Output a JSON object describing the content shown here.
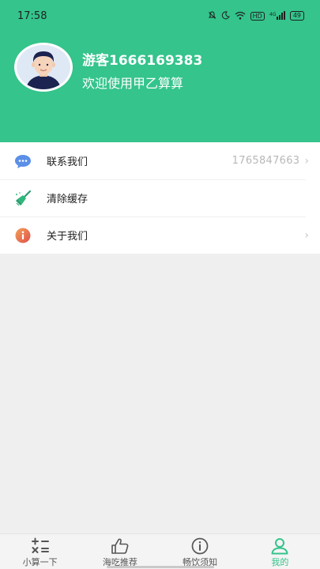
{
  "status_bar": {
    "time": "17:58",
    "signal_badge": "HD",
    "network_label": "4G",
    "battery": "49"
  },
  "profile": {
    "username": "游客1666169383",
    "welcome": "欢迎使用甲乙算算"
  },
  "menu": {
    "items": [
      {
        "label": "联系我们",
        "value": "1765847663",
        "icon": "chat-bubble-icon"
      },
      {
        "label": "清除缓存",
        "value": "",
        "icon": "broom-icon"
      },
      {
        "label": "关于我们",
        "value": "",
        "icon": "info-icon"
      }
    ]
  },
  "tabbar": {
    "tabs": [
      {
        "label": "小算一下",
        "icon": "calculator-icon",
        "active": false
      },
      {
        "label": "海吃推荐",
        "icon": "thumbs-up-icon",
        "active": false
      },
      {
        "label": "畅饮须知",
        "icon": "info-circle-icon",
        "active": false
      },
      {
        "label": "我的",
        "icon": "user-icon",
        "active": true
      }
    ]
  },
  "colors": {
    "brand": "#34c48c",
    "background": "#efefef"
  }
}
